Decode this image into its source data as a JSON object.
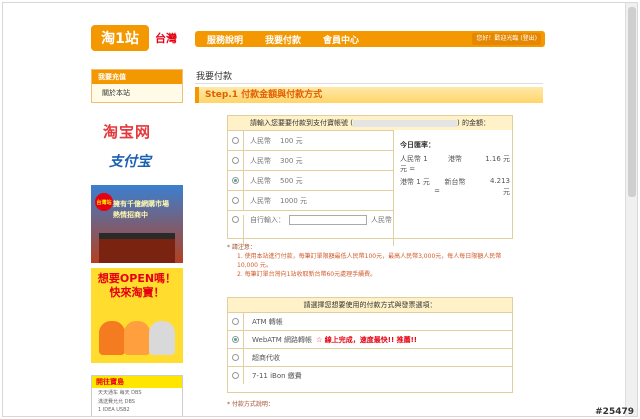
{
  "header": {
    "logo_text": "淘1站",
    "logo_sub": "台灣",
    "nav": [
      "服務說明",
      "我要付款",
      "會員中心"
    ],
    "user_text": "您好！歡迎光臨 (登出)"
  },
  "sidebar": {
    "head": "我要充值",
    "links": [
      "關於本站"
    ]
  },
  "brands": {
    "taobao": "淘宝网",
    "alipay": "支付宝"
  },
  "ads": {
    "ad1_badge": "台灣站",
    "ad1_title": "擁有千億網購市場\n熱情招商中",
    "ad2_title": "想要OPEN嗎！\n快來淘寶！",
    "ad3_head": "開往寶島",
    "ad3_lines": [
      "天天通车 每天 DBS",
      "滿送費允允 DBS",
      "1 IDEA USB2"
    ]
  },
  "main": {
    "page_title": "我要付款",
    "step_title": "Step.1 付款金額與付款方式"
  },
  "amount_panel": {
    "head_prefix": "請輸入您要要付款到支付寶帳號 (",
    "head_suffix": ") 的金額：",
    "amounts": [
      {
        "cur": "人民幣",
        "value": "100 元",
        "selected": false
      },
      {
        "cur": "人民幣",
        "value": "300 元",
        "selected": false
      },
      {
        "cur": "人民幣",
        "value": "500 元",
        "selected": true
      },
      {
        "cur": "人民幣",
        "value": "1000 元",
        "selected": false
      }
    ],
    "custom_label": "自行輸入：",
    "custom_unit": "人民幣",
    "custom_value": ""
  },
  "rate": {
    "title": "今日匯率：",
    "line1_left": "人民幣 1",
    "line1_mid": "港幣",
    "line1_val": "1.16 元",
    "line1_eq": "元 =",
    "line2_left": "港幣 1 元",
    "line2_mid": "新台幣",
    "line2_val": "4.213",
    "line2_eq": "=",
    "line2_unit": "元"
  },
  "notes": {
    "title": "* 請注意：",
    "items": [
      "1. 使用本站進行付款，每筆訂單限額最低人民幣100元，最高人民幣3,000元，每人每日限額人民幣 10,000 元。",
      "2. 每筆訂單台灣向1站收取新台幣60元處理手續費。"
    ]
  },
  "payment_panel": {
    "head": "請選擇您想要使用的付款方式與發票選項：",
    "options": [
      {
        "label": "ATM 轉帳",
        "hot": "",
        "selected": false
      },
      {
        "label": "WebATM 網路轉帳",
        "hot": "☆ 線上完成，速度最快!! 推薦!!",
        "selected": true
      },
      {
        "label": "超商代收",
        "hot": "",
        "selected": false
      },
      {
        "label": "7-11 iBon 繳費",
        "hot": "",
        "selected": false
      }
    ]
  },
  "desc_title": "* 付款方式說明：",
  "watermark": "#25479",
  "colors": {
    "accent": "#f39800",
    "red": "#e60012",
    "panel_border": "#e2cfa0"
  }
}
